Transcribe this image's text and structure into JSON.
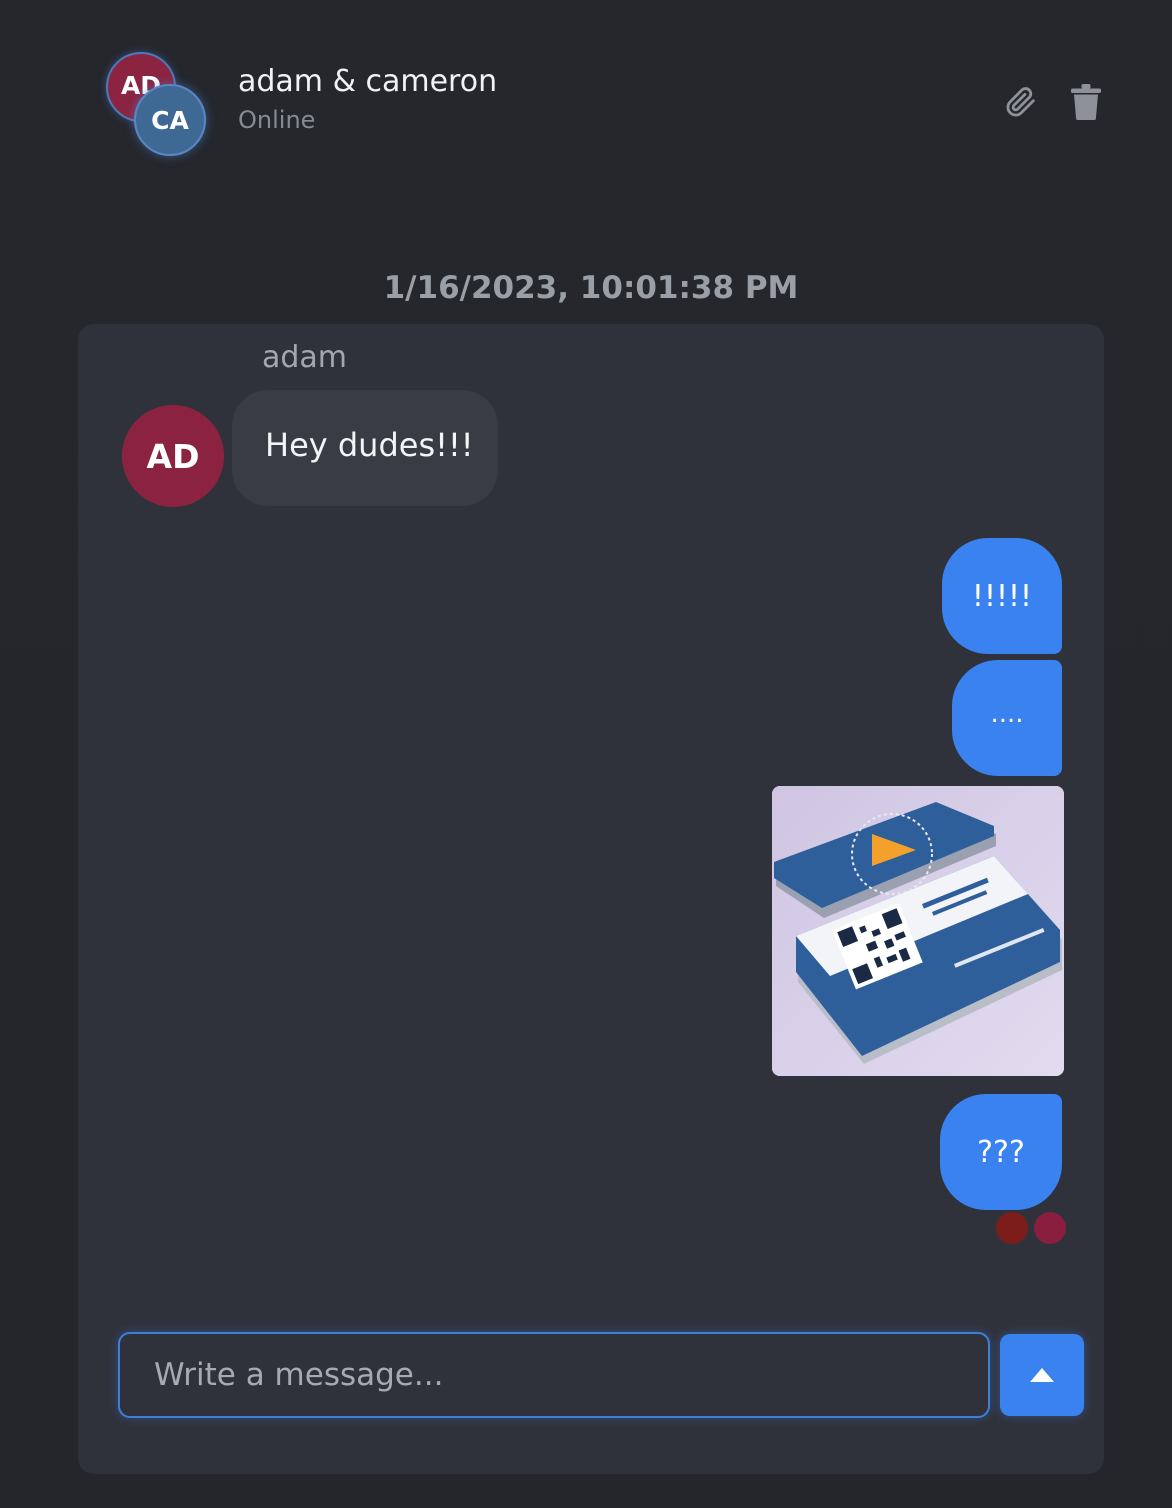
{
  "header": {
    "avatars": [
      {
        "initials": "AD",
        "color": "#8a2440"
      },
      {
        "initials": "CA",
        "color": "#3f6995"
      }
    ],
    "title": "adam & cameron",
    "status": "Online",
    "icons": [
      "paperclip-icon",
      "trash-icon"
    ]
  },
  "conversation": {
    "timestamp": "1/16/2023, 10:01:38 PM",
    "incoming": {
      "sender": "adam",
      "initials": "AD",
      "text": "Hey dudes!!!"
    },
    "outgoing": [
      {
        "text": "!!!!!"
      },
      {
        "text": "...."
      },
      {
        "image": "business-cards-photo"
      },
      {
        "text": "???"
      }
    ],
    "read_receipts": [
      "#7d1d1b",
      "#8a1e3e"
    ]
  },
  "composer": {
    "placeholder": "Write a message...",
    "send_icon": "caret-up-icon"
  },
  "colors": {
    "accent": "#3a82f0",
    "background": "#24262c",
    "panel": "#30323b"
  }
}
